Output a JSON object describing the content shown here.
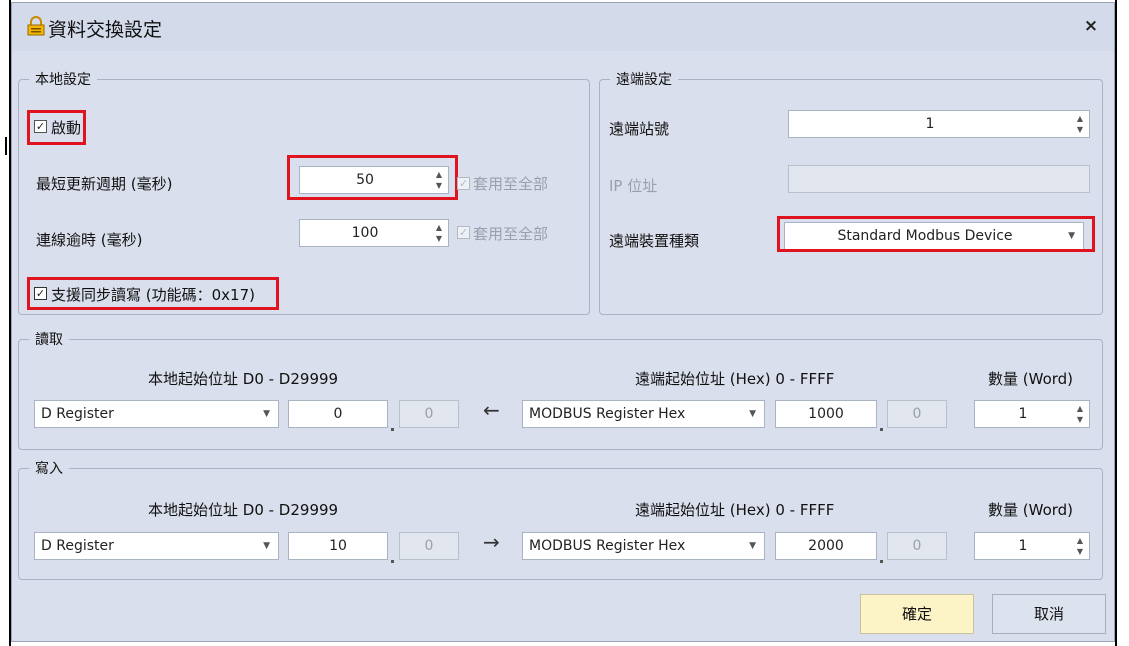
{
  "window": {
    "title": "資料交換設定",
    "close_glyph": "×"
  },
  "local": {
    "legend": "本地設定",
    "enable_label": "啟動",
    "update_cycle_label": "最短更新週期 (毫秒)",
    "update_cycle_value": "50",
    "timeout_label": "連線逾時 (毫秒)",
    "timeout_value": "100",
    "apply_all_label": "套用至全部",
    "sync_rw_label": "支援同步讀寫 (功能碼：0x17)"
  },
  "remote": {
    "legend": "遠端設定",
    "station_label": "遠端站號",
    "station_value": "1",
    "ip_label": "IP 位址",
    "ip_value": "",
    "device_type_label": "遠端裝置種類",
    "device_type_value": "Standard Modbus Device"
  },
  "read": {
    "legend": "讀取",
    "local_header": "本地起始位址 D0 - D29999",
    "remote_header": "遠端起始位址 (Hex) 0 - FFFF",
    "count_header": "數量 (Word)",
    "local_type": "D Register",
    "local_addr": "0",
    "local_bit": "0",
    "arrow": "←",
    "remote_type": "MODBUS Register Hex",
    "remote_addr": "1000",
    "remote_bit": "0",
    "count": "1"
  },
  "write": {
    "legend": "寫入",
    "local_header": "本地起始位址 D0 - D29999",
    "remote_header": "遠端起始位址 (Hex) 0 - FFFF",
    "count_header": "數量 (Word)",
    "local_type": "D Register",
    "local_addr": "10",
    "local_bit": "0",
    "arrow": "→",
    "remote_type": "MODBUS Register Hex",
    "remote_addr": "2000",
    "remote_bit": "0",
    "count": "1"
  },
  "buttons": {
    "ok": "確定",
    "cancel": "取消"
  },
  "colors": {
    "highlight": "#e0141e",
    "dialog_bg": "#d9dfec",
    "ok_bg": "#fcf3c6"
  },
  "icons": {
    "title": "lock-icon",
    "spin": "spin-arrows-icon",
    "dropdown": "chevron-down-icon"
  }
}
